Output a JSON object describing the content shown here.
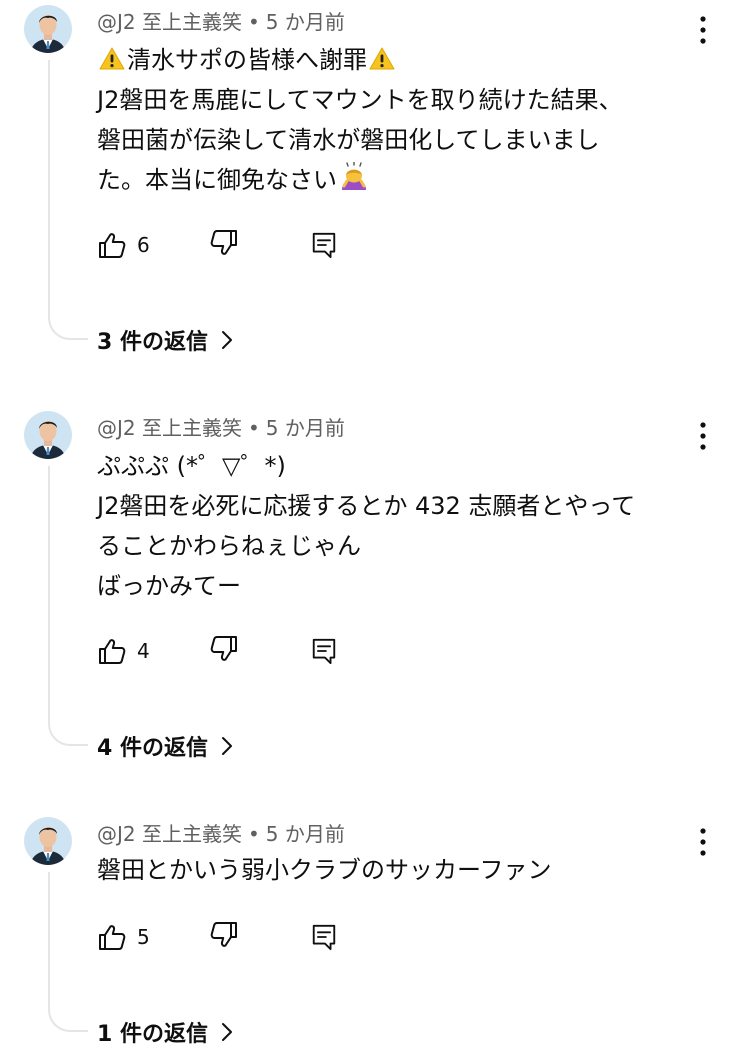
{
  "comments": [
    {
      "author": "@J2 至上主義笑",
      "time": "5 か月前",
      "line1": "清水サポの皆様へ謝罪",
      "line2": "J2磐田を馬鹿にしてマウントを取り続けた結果、",
      "line3": "磐田菌が伝染して清水が磐田化してしまいまし",
      "line4": "た。本当に御免なさい",
      "likes": "6",
      "replies": "3 件の返信"
    },
    {
      "author": "@J2 至上主義笑",
      "time": "5 か月前",
      "line1": "ぷぷぷ (*゜▽゜*)",
      "line2": "J2磐田を必死に応援するとか 432 志願者とやって",
      "line3": "ることかわらねぇじゃん",
      "line4": "ばっかみてー",
      "likes": "4",
      "replies": "4 件の返信"
    },
    {
      "author": "@J2 至上主義笑",
      "time": "5 か月前",
      "line1": "磐田とかいう弱小クラブのサッカーファン",
      "likes": "5",
      "replies": "1 件の返信"
    }
  ],
  "meta_separator": "•",
  "icons": {
    "warning": "warning-emoji-icon",
    "bow": "bowing-person-emoji-icon",
    "like": "thumbs-up-icon",
    "dislike": "thumbs-down-icon",
    "reply": "reply-comment-icon",
    "menu": "more-vertical-icon",
    "chevron": "chevron-right-icon"
  },
  "colors": {
    "text": "#0f0f0f",
    "meta": "#606060",
    "thread_line": "#e5e5e5",
    "avatar_bg": "#cfe4f2"
  }
}
